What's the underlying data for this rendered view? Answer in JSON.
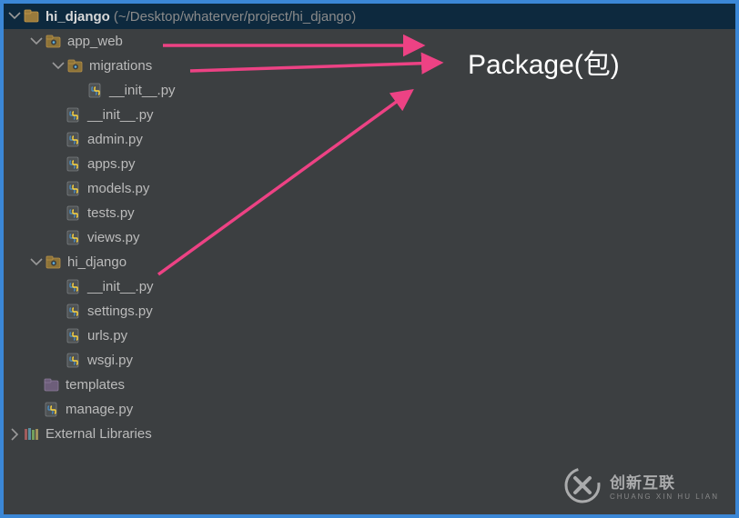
{
  "root": {
    "name": "hi_django",
    "path": "(~/Desktop/whaterver/project/hi_django)"
  },
  "tree": {
    "app_web": {
      "label": "app_web",
      "migrations": {
        "label": "migrations",
        "files": [
          "__init__.py"
        ]
      },
      "files": [
        "__init__.py",
        "admin.py",
        "apps.py",
        "models.py",
        "tests.py",
        "views.py"
      ]
    },
    "hi_django": {
      "label": "hi_django",
      "files": [
        "__init__.py",
        "settings.py",
        "urls.py",
        "wsgi.py"
      ]
    },
    "templates": {
      "label": "templates"
    },
    "manage": {
      "label": "manage.py"
    },
    "external": {
      "label": "External Libraries"
    }
  },
  "annotation": {
    "label": "Package(包)"
  },
  "watermark": {
    "brand": "创新互联",
    "sub": "CHUANG XIN HU LIAN"
  },
  "colors": {
    "selection": "#0d293e",
    "border": "#3b87d6",
    "arrow": "#ed4284",
    "bg": "#3c3f41"
  }
}
